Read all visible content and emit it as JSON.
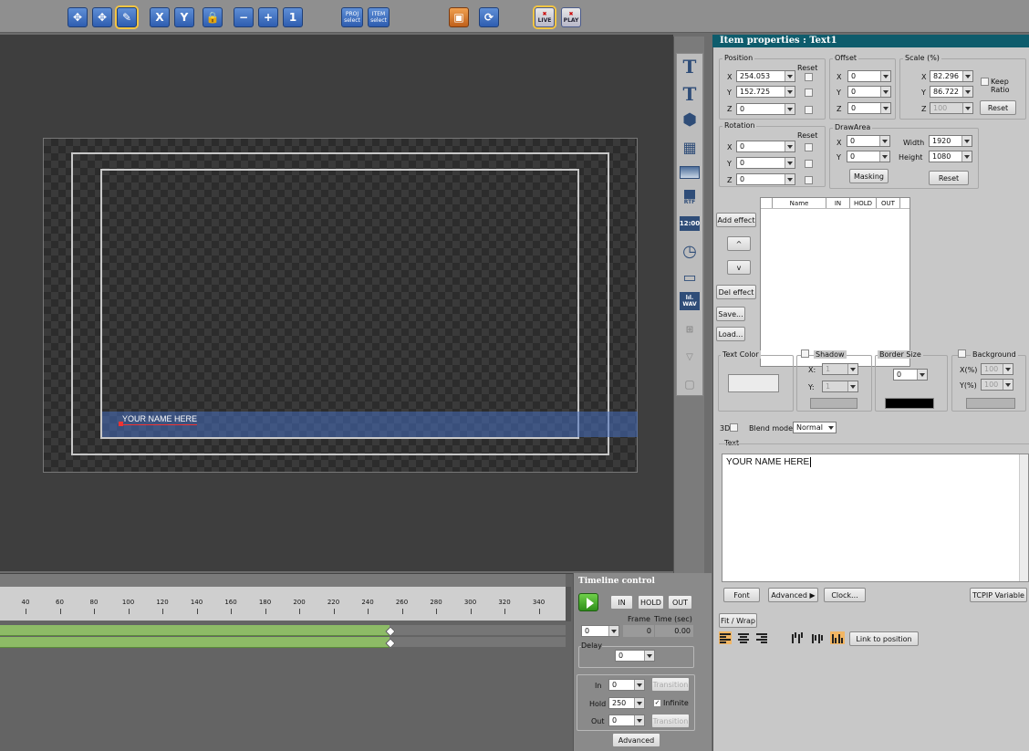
{
  "toolbar": {
    "x": "X",
    "y": "Y",
    "proj_top": "PROJ",
    "proj_bottom": "select",
    "item_top": "ITEM",
    "item_bottom": "select",
    "live": "LIVE",
    "play": "PLAY"
  },
  "canvas": {
    "text_item": "YOUR NAME HERE"
  },
  "vstrip": {
    "clock": "12:00",
    "wav": "WAV",
    "rtf": "RTF"
  },
  "panel": {
    "title": "Item properties : Text1",
    "position": {
      "label": "Position",
      "reset": "Reset",
      "x_label": "X",
      "y_label": "Y",
      "z_label": "Z",
      "x": "254.053",
      "y": "152.725",
      "z": "0"
    },
    "offset": {
      "label": "Offset",
      "x_label": "X",
      "y_label": "Y",
      "z_label": "Z",
      "x": "0",
      "y": "0",
      "z": "0"
    },
    "scale": {
      "label": "Scale (%)",
      "x_label": "X",
      "y_label": "Y",
      "z_label": "Z",
      "x": "82.296",
      "y": "86.722",
      "z": "100",
      "keep_ratio": "Keep Ratio",
      "reset": "Reset"
    },
    "rotation": {
      "label": "Rotation",
      "reset": "Reset",
      "x_label": "X",
      "y_label": "Y",
      "z_label": "Z",
      "x": "0",
      "y": "0",
      "z": "0"
    },
    "drawarea": {
      "label": "DrawArea",
      "x_label": "X",
      "y_label": "Y",
      "x": "0",
      "y": "0",
      "width_label": "Width",
      "height_label": "Height",
      "width": "1920",
      "height": "1080",
      "masking": "Masking",
      "reset": "Reset"
    },
    "effects": {
      "columns": [
        "Name",
        "IN",
        "HOLD",
        "OUT"
      ],
      "add": "Add effect",
      "up": "^",
      "down": "v",
      "del": "Del effect",
      "save": "Save...",
      "load": "Load..."
    },
    "text_color": "Text Color",
    "shadow": {
      "label": "Shadow",
      "x_label": "X:",
      "y_label": "Y:",
      "x": "1",
      "y": "1"
    },
    "border": {
      "label": "Border Size",
      "value": "0"
    },
    "background": {
      "label": "Background",
      "x_label": "X(%)",
      "y_label": "Y(%)",
      "x": "100",
      "y": "100"
    },
    "three_d": "3D",
    "blend_label": "Blend mode:",
    "blend_value": "Normal",
    "text_label": "Text",
    "text_value": "YOUR NAME HERE",
    "buttons": {
      "font": "Font",
      "advanced": "Advanced ▶",
      "clock": "Clock...",
      "tcpip": "TCPIP Variable",
      "fit": "Fit / Wrap",
      "link": "Link to position"
    }
  },
  "timeline": {
    "ticks": [
      "40",
      "60",
      "80",
      "100",
      "120",
      "140",
      "160",
      "180",
      "200",
      "220",
      "240",
      "260",
      "280",
      "300",
      "320",
      "340"
    ]
  },
  "tcontrol": {
    "title": "Timeline control",
    "in": "IN",
    "hold": "HOLD",
    "out": "OUT",
    "frame_label": "Frame",
    "time_label": "Time (sec)",
    "frame_combo": "0",
    "frame_value": "0",
    "time_value": "0.00",
    "delay_label": "Delay",
    "delay": "0",
    "in_label": "In",
    "in_value": "0",
    "hold_label": "Hold",
    "hold_value": "250",
    "out_label": "Out",
    "out_value": "0",
    "transition": "Transition",
    "infinite": "Infinite",
    "advanced": "Advanced"
  }
}
